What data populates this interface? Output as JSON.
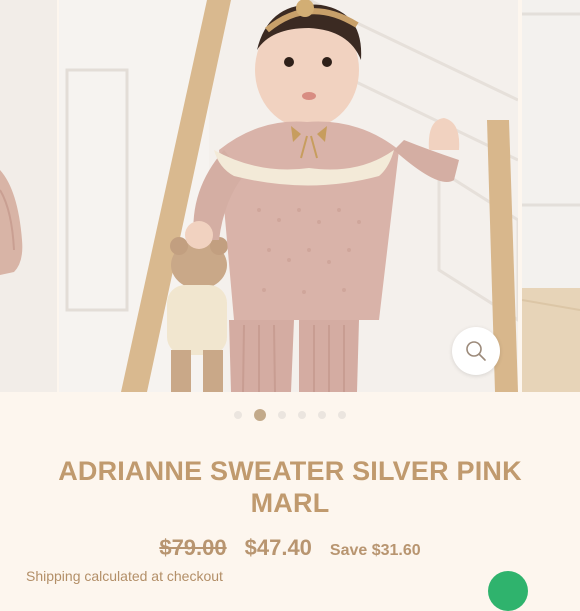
{
  "gallery": {
    "slide_count": 6,
    "active_slide": 2,
    "zoom_icon": "search-icon"
  },
  "product": {
    "title": "ADRIANNE SWEATER SILVER PINK MARL",
    "compare_price": "$79.00",
    "sale_price": "$47.40",
    "savings": "Save $31.60"
  },
  "shipping": {
    "text": "Shipping calculated at checkout"
  },
  "colors": {
    "background": "#fdf6ee",
    "accent": "#c09a6e",
    "active_dot": "#c3aa8a",
    "sweater": "#d9b3a9"
  }
}
